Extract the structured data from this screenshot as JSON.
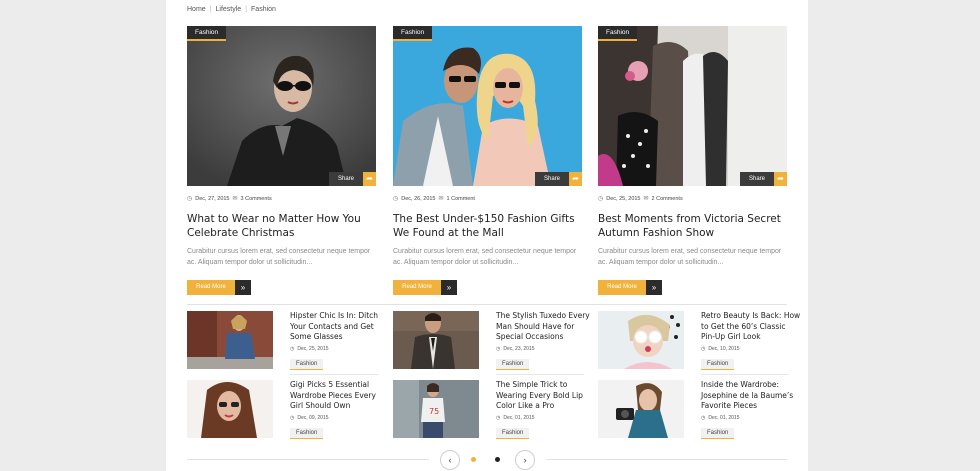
{
  "breadcrumb": [
    "Home",
    "Lifestyle",
    "Fashion"
  ],
  "colors": {
    "accent": "#f0b23a",
    "dark": "#2b2b2b"
  },
  "featured": [
    {
      "tag": "Fashion",
      "share": "Share",
      "date": "Dec, 27, 2015",
      "comments": "3 Comments",
      "title": "What to Wear no Matter How You Celebrate Christmas",
      "excerpt": "Curabitur cursus lorem erat, sed consectetur neque tempor ac. Aliquam tempor dolor ut sollicitudin...",
      "read_more": "Read More"
    },
    {
      "tag": "Fashion",
      "share": "Share",
      "date": "Dec, 26, 2015",
      "comments": "1 Comment",
      "title": "The Best Under-$150 Fashion Gifts We Found at the Mall",
      "excerpt": "Curabitur cursus lorem erat, sed consectetur neque tempor ac. Aliquam tempor dolor ut sollicitudin...",
      "read_more": "Read More"
    },
    {
      "tag": "Fashion",
      "share": "Share",
      "date": "Dec, 25, 2015",
      "comments": "2 Comments",
      "title": "Best Moments from Victoria Secret Autumn Fashion Show",
      "excerpt": "Curabitur cursus lorem erat, sed consectetur neque tempor ac. Aliquam tempor dolor ut sollicitudin...",
      "read_more": "Read More"
    }
  ],
  "list": [
    {
      "title": "Hipster Chic Is In: Ditch Your Contacts and Get Some Glasses",
      "date": "Dec, 25, 2015",
      "category": "Fashion"
    },
    {
      "title": "The Stylish Tuxedo Every Man Should Have for Special Occasions",
      "date": "Dec, 23, 2015",
      "category": "Fashion"
    },
    {
      "title": "Retro Beauty Is Back: How to Get the 60’s Classic Pin-Up Girl Look",
      "date": "Dec, 10, 2015",
      "category": "Fashion"
    },
    {
      "title": "Gigi Picks 5 Essential Wardrobe Pieces Every Girl Should Own",
      "date": "Dec, 09, 2015",
      "category": "Fashion"
    },
    {
      "title": "The Simple Trick to Wearing Every Bold Lip Color Like a Pro",
      "date": "Dec, 01, 2015",
      "category": "Fashion"
    },
    {
      "title": "Inside the Wardrobe: Josephine de la Baume’s Favorite Pieces",
      "date": "Dec, 01, 2015",
      "category": "Fashion"
    }
  ],
  "pager": {
    "prev_icon": "chevron-left-icon",
    "next_icon": "chevron-right-icon",
    "prev": "‹",
    "next": "›"
  }
}
